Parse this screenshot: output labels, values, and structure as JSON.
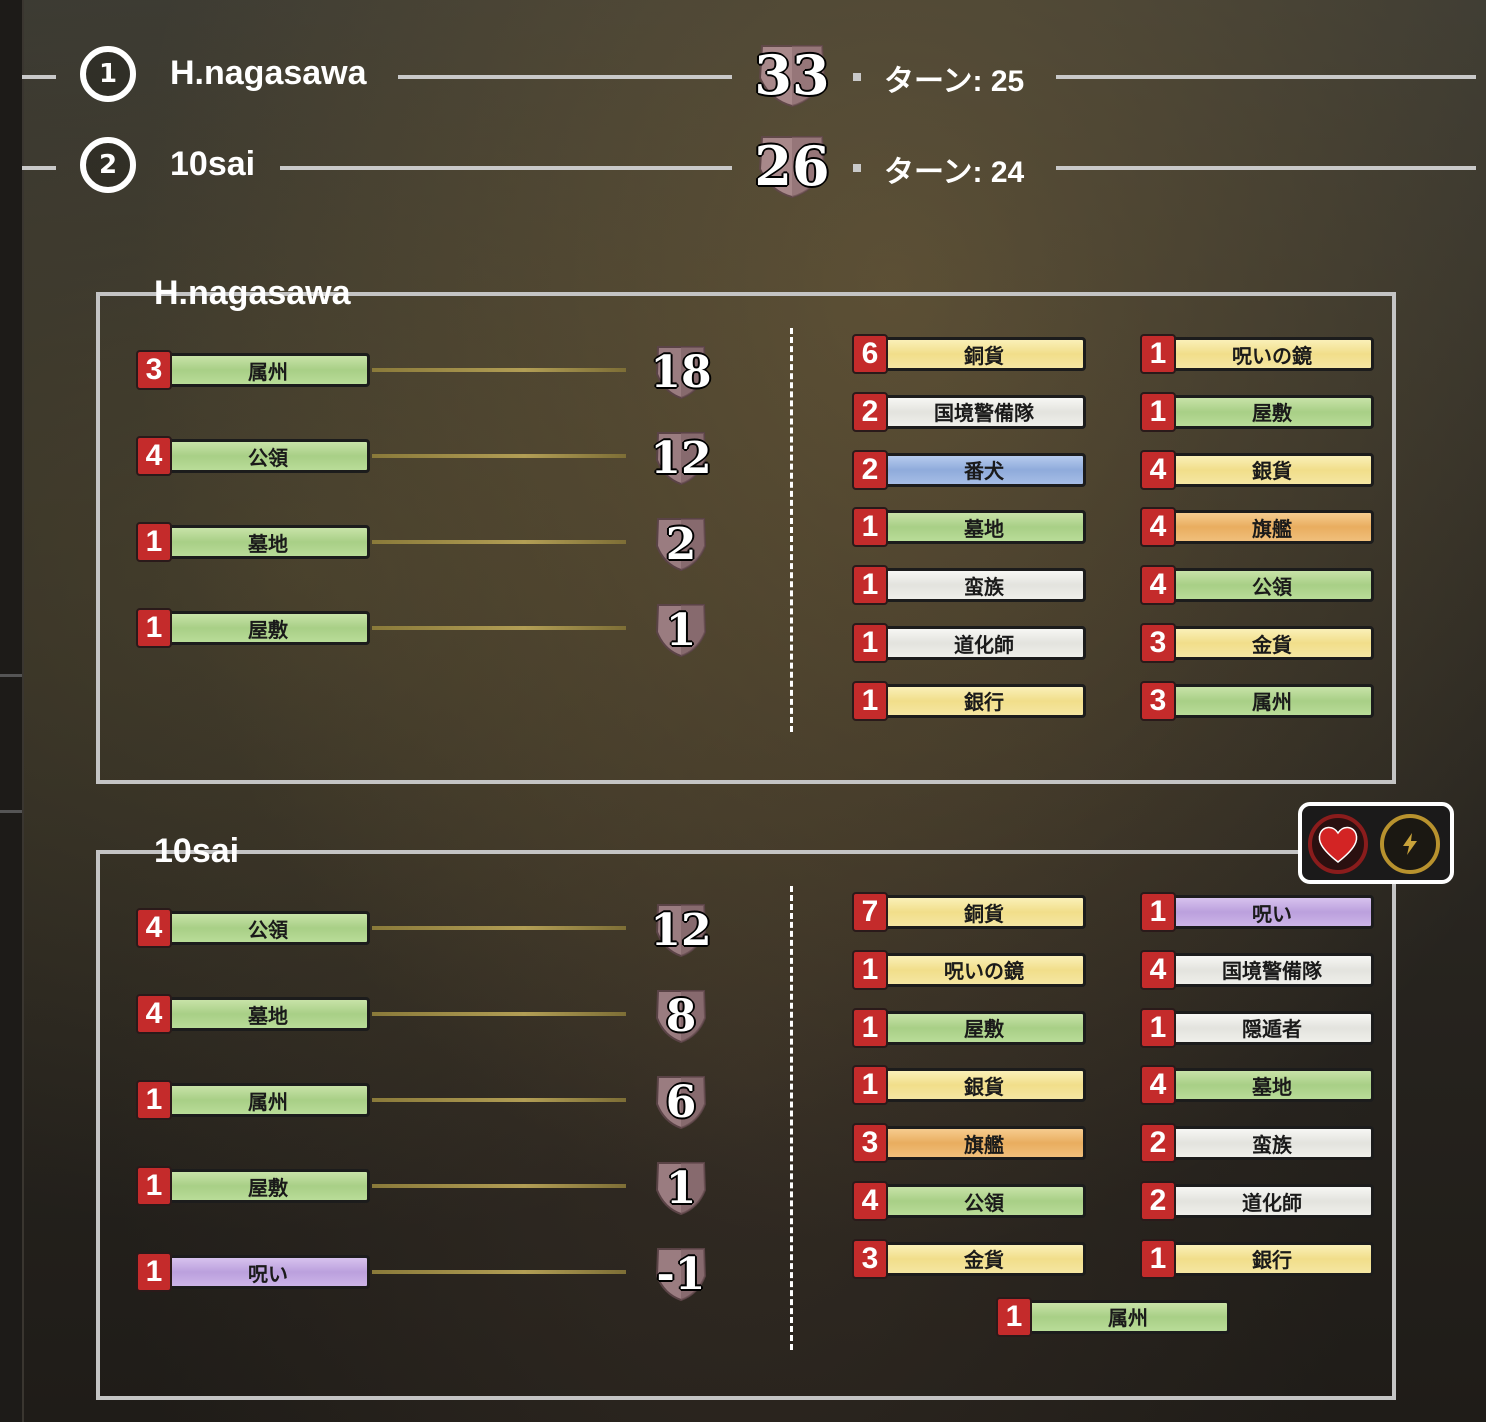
{
  "ranking": [
    {
      "rank": "1",
      "name": "H.nagasawa",
      "score": "33",
      "turns": "ターン: 25"
    },
    {
      "rank": "2",
      "name": "10sai",
      "score": "26",
      "turns": "ターン: 24"
    }
  ],
  "players": [
    {
      "name": "H.nagasawa",
      "score_cards": [
        {
          "count": "3",
          "name": "属州",
          "points": "18",
          "color": "green"
        },
        {
          "count": "4",
          "name": "公領",
          "points": "12",
          "color": "green"
        },
        {
          "count": "1",
          "name": "墓地",
          "points": "2",
          "color": "green"
        },
        {
          "count": "1",
          "name": "屋敷",
          "points": "1",
          "color": "green"
        }
      ],
      "deck": [
        {
          "count": "6",
          "name": "銅貨",
          "color": "yellow"
        },
        {
          "count": "1",
          "name": "呪いの鏡",
          "color": "yellow"
        },
        {
          "count": "2",
          "name": "国境警備隊",
          "color": "white"
        },
        {
          "count": "1",
          "name": "屋敷",
          "color": "green"
        },
        {
          "count": "2",
          "name": "番犬",
          "color": "blue"
        },
        {
          "count": "4",
          "name": "銀貨",
          "color": "yellow"
        },
        {
          "count": "1",
          "name": "墓地",
          "color": "green"
        },
        {
          "count": "4",
          "name": "旗艦",
          "color": "orange"
        },
        {
          "count": "1",
          "name": "蛮族",
          "color": "white"
        },
        {
          "count": "4",
          "name": "公領",
          "color": "green"
        },
        {
          "count": "1",
          "name": "道化師",
          "color": "white"
        },
        {
          "count": "3",
          "name": "金貨",
          "color": "yellow"
        },
        {
          "count": "1",
          "name": "銀行",
          "color": "yellow"
        },
        {
          "count": "3",
          "name": "属州",
          "color": "green"
        }
      ]
    },
    {
      "name": "10sai",
      "score_cards": [
        {
          "count": "4",
          "name": "公領",
          "points": "12",
          "color": "green"
        },
        {
          "count": "4",
          "name": "墓地",
          "points": "8",
          "color": "green"
        },
        {
          "count": "1",
          "name": "属州",
          "points": "6",
          "color": "green"
        },
        {
          "count": "1",
          "name": "屋敷",
          "points": "1",
          "color": "green"
        },
        {
          "count": "1",
          "name": "呪い",
          "points": "-1",
          "color": "purple"
        }
      ],
      "deck": [
        {
          "count": "7",
          "name": "銅貨",
          "color": "yellow"
        },
        {
          "count": "1",
          "name": "呪い",
          "color": "purple"
        },
        {
          "count": "1",
          "name": "呪いの鏡",
          "color": "yellow"
        },
        {
          "count": "4",
          "name": "国境警備隊",
          "color": "white"
        },
        {
          "count": "1",
          "name": "屋敷",
          "color": "green"
        },
        {
          "count": "1",
          "name": "隠遁者",
          "color": "white"
        },
        {
          "count": "1",
          "name": "銀貨",
          "color": "yellow"
        },
        {
          "count": "4",
          "name": "墓地",
          "color": "green"
        },
        {
          "count": "3",
          "name": "旗艦",
          "color": "orange"
        },
        {
          "count": "2",
          "name": "蛮族",
          "color": "white"
        },
        {
          "count": "4",
          "name": "公領",
          "color": "green"
        },
        {
          "count": "2",
          "name": "道化師",
          "color": "white"
        },
        {
          "count": "3",
          "name": "金貨",
          "color": "yellow"
        },
        {
          "count": "1",
          "name": "銀行",
          "color": "yellow"
        },
        {
          "count": "1",
          "name": "属州",
          "color": "green"
        }
      ]
    }
  ],
  "badges": [
    {
      "icon": "heart-icon",
      "color": "#c42b2b"
    },
    {
      "icon": "lightning-icon",
      "color": "#c8a23a"
    }
  ]
}
